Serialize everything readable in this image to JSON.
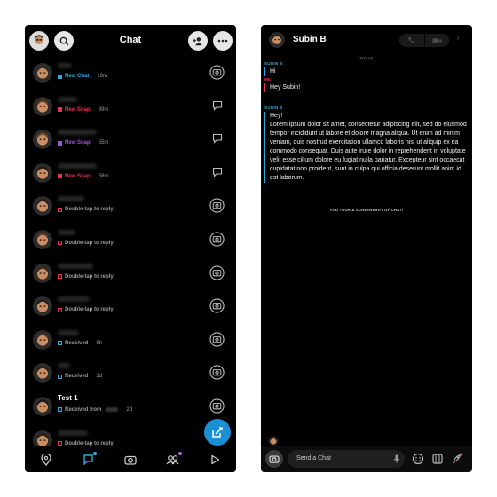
{
  "left": {
    "title": "Chat",
    "chats": [
      {
        "name": "",
        "status": "New Chat",
        "status_type": "new-chat",
        "time": "19m",
        "emoji": "😊",
        "action": "camera"
      },
      {
        "name": "",
        "status": "New Snap",
        "status_type": "new-snap",
        "time": "39m",
        "emoji": "",
        "action": "chat"
      },
      {
        "name": "",
        "status": "New Snap",
        "status_type": "new-snap-purple",
        "time": "55m",
        "emoji": "😊",
        "action": "chat"
      },
      {
        "name": "",
        "status": "New Snap",
        "status_type": "new-snap",
        "time": "58m",
        "emoji": "",
        "action": "chat"
      },
      {
        "name": "",
        "status": "Double-tap to reply",
        "status_type": "opened-red",
        "time": "",
        "emoji": "",
        "action": "camera"
      },
      {
        "name": "",
        "status": "Double-tap to reply",
        "status_type": "opened-red",
        "time": "",
        "emoji": "😊",
        "action": "camera"
      },
      {
        "name": "",
        "status": "Double-tap to reply",
        "status_type": "opened-red",
        "time": "",
        "emoji": "",
        "action": "camera"
      },
      {
        "name": "",
        "status": "Double-tap to reply",
        "status_type": "opened-red",
        "time": "",
        "emoji": "",
        "action": "camera"
      },
      {
        "name": "",
        "status": "Received",
        "status_type": "received-blue",
        "time": "9h",
        "emoji": "",
        "action": "camera"
      },
      {
        "name": "",
        "status": "Received",
        "status_type": "received-blue",
        "time": "1d",
        "emoji": "",
        "action": "camera"
      },
      {
        "name": "Test 1",
        "status": "Received from",
        "status_type": "received-blue",
        "time": "2d",
        "emoji": "",
        "action": "camera"
      },
      {
        "name": "",
        "status": "Double-tap to reply",
        "status_type": "opened-red",
        "time": "",
        "emoji": "",
        "action": "none"
      }
    ],
    "nav": [
      "map",
      "chat",
      "camera",
      "friends",
      "stories"
    ]
  },
  "right": {
    "contact_name": "Subin B",
    "today_label": "TODAY",
    "messages": [
      {
        "sender": "SUBIN B",
        "color": "blue",
        "text": "Hi"
      },
      {
        "sender": "ME",
        "color": "red",
        "text": "Hey Subin!"
      },
      {
        "sender": "SUBIN B",
        "color": "blue",
        "text": "Hey!"
      },
      {
        "sender": "",
        "color": "blue",
        "text": "Lorem ipsum dolor sit amet, consectetur adipiscing elit, sed do eiusmod tempor incididunt ut labore et dolore magna aliqua. Ut enim ad minim veniam, quis nostrud exercitation ullamco laboris nisi ut aliquip ex ea commodo consequat. Duis aute irure dolor in reprehenderit in voluptate velit esse cillum dolore eu fugiat nulla pariatur. Excepteur sint occaecat cupidatat non proident, sunt in culpa qui officia deserunt mollit anim id est laborum."
      }
    ],
    "screenshot_note": "YOU TOOK A SCREENSHOT OF CHAT!",
    "compose_placeholder": "Send a Chat"
  },
  "colors": {
    "blue": "#2aa9e0",
    "red": "#e8334f",
    "purple": "#9b59d0",
    "fab": "#1a8fd4"
  }
}
